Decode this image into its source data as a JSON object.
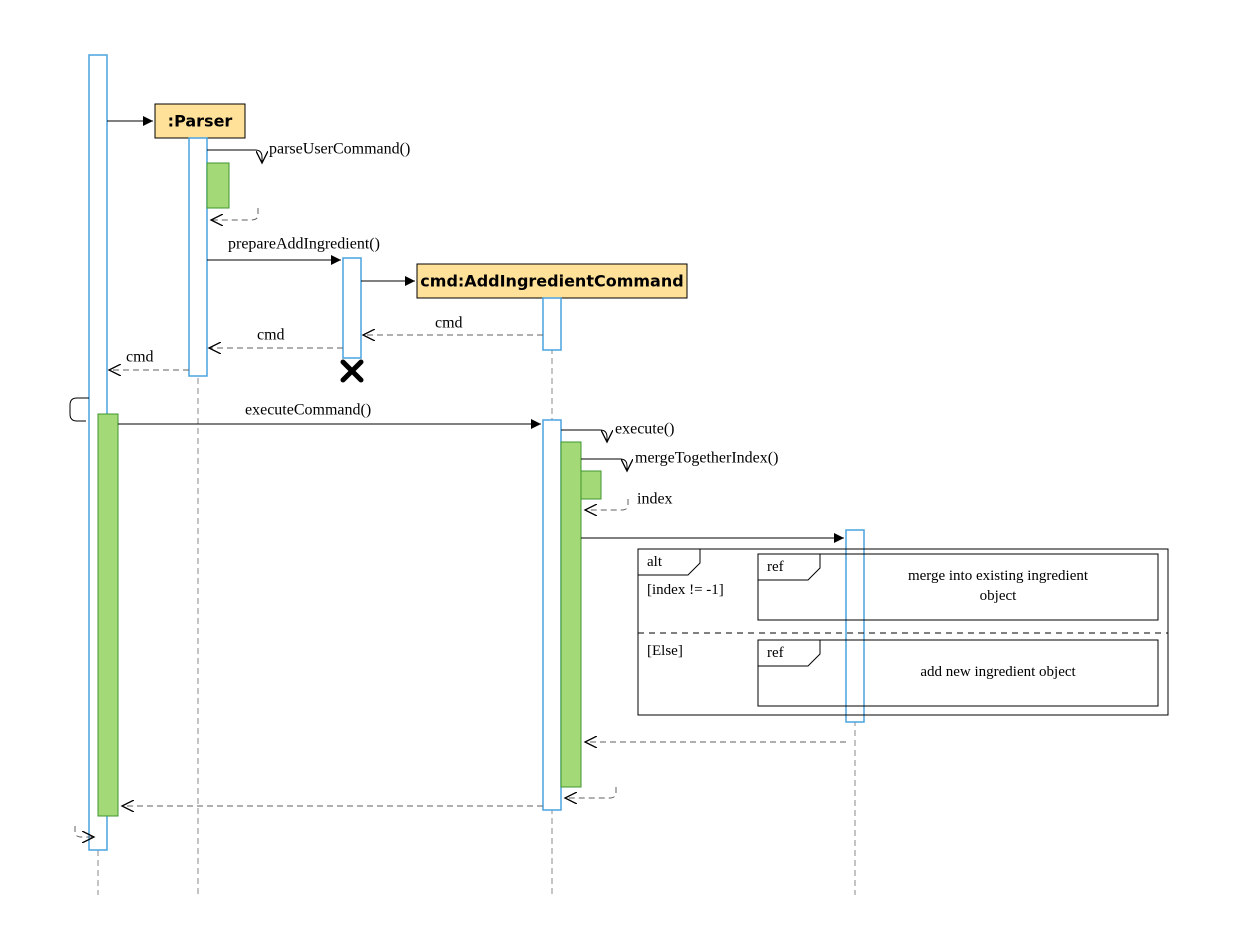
{
  "participants": {
    "parser": ":Parser",
    "cmd": "cmd:AddIngredientCommand"
  },
  "messages": {
    "parseUserCommand": "parseUserCommand()",
    "prepareAddIngredient": "prepareAddIngredient()",
    "cmdReturn1": "cmd",
    "cmdReturn2": "cmd",
    "cmdReturn3": "cmd",
    "executeCommand": "executeCommand()",
    "execute": "execute()",
    "mergeTogetherIndex": "mergeTogetherIndex()",
    "indexReturn": "index"
  },
  "fragment": {
    "altLabel": "alt",
    "guard1": "[index != -1]",
    "guard2": "[Else]",
    "refLabel": "ref",
    "refText1a": "merge into existing ingredient",
    "refText1b": "object",
    "refText2": "add new ingredient object"
  }
}
